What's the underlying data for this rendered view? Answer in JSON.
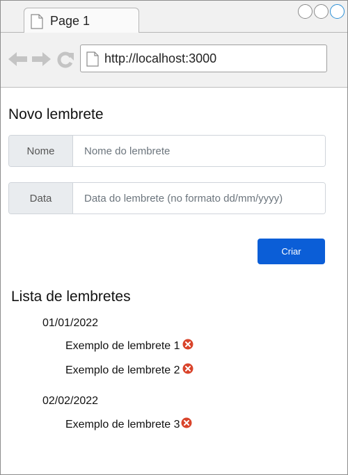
{
  "browser": {
    "tab_title": "Page 1",
    "url": "http://localhost:3000",
    "icons": {
      "back": "arrow-left-icon",
      "forward": "arrow-right-icon",
      "reload": "reload-icon",
      "page": "page-icon"
    }
  },
  "form": {
    "title": "Novo lembrete",
    "name_label": "Nome",
    "name_placeholder": "Nome do lembrete",
    "name_value": "",
    "date_label": "Data",
    "date_placeholder": "Data do lembrete (no formato dd/mm/yyyy)",
    "date_value": "",
    "submit_label": "Criar"
  },
  "list": {
    "title": "Lista de lembretes",
    "groups": [
      {
        "date": "01/01/2022",
        "items": [
          {
            "text": "Exemplo de lembrete 1"
          },
          {
            "text": "Exemplo de lembrete 2"
          }
        ]
      },
      {
        "date": "02/02/2022",
        "items": [
          {
            "text": "Exemplo de lembrete 3"
          }
        ]
      }
    ],
    "remove_icon": "remove-circle-icon"
  },
  "colors": {
    "primary_button": "#0b5ed7",
    "remove_icon": "#d9442b",
    "addon_background": "#e9ecef"
  }
}
